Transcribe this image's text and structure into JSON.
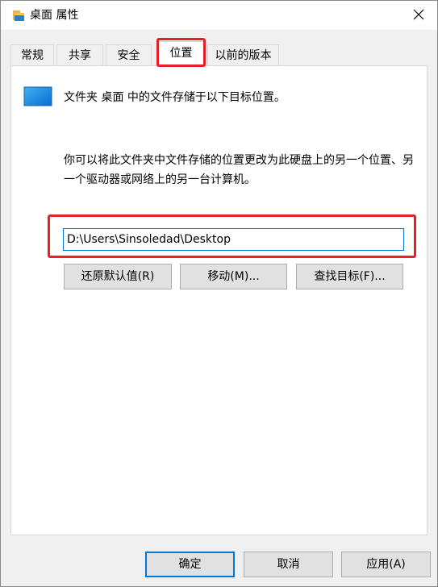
{
  "window": {
    "title": "桌面 属性",
    "close_icon": "close-icon",
    "title_icon": "folder-icon"
  },
  "tabs": [
    {
      "label": "常规",
      "active": false
    },
    {
      "label": "共享",
      "active": false
    },
    {
      "label": "安全",
      "active": false
    },
    {
      "label": "位置",
      "active": true
    },
    {
      "label": "以前的版本",
      "active": false
    }
  ],
  "location": {
    "intro": "文件夹 桌面 中的文件存储于以下目标位置。",
    "description": "你可以将此文件夹中文件存储的位置更改为此硬盘上的另一个位置、另一个驱动器或网络上的另一台计算机。",
    "path_value": "D:\\Users\\Sinsoledad\\Desktop",
    "buttons": {
      "restore": "还原默认值(R)",
      "move": "移动(M)...",
      "find_target": "查找目标(F)..."
    }
  },
  "footer": {
    "ok": "确定",
    "cancel": "取消",
    "apply": "应用(A)"
  },
  "colors": {
    "highlight": "#e81e2b",
    "accent": "#0078d7"
  }
}
